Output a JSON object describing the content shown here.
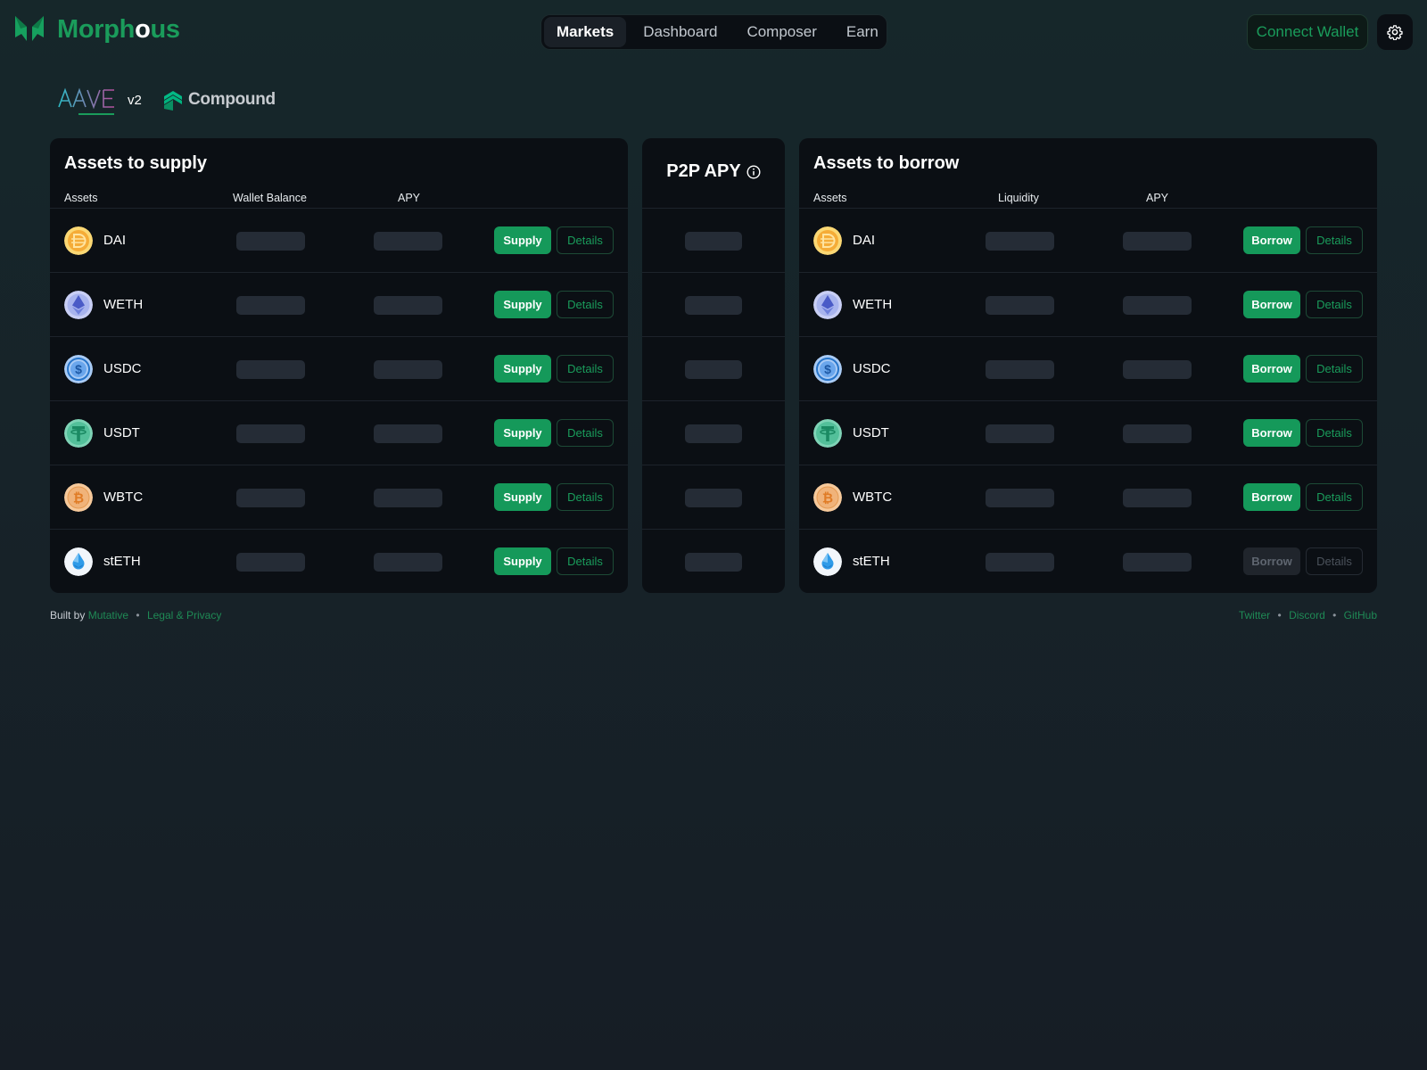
{
  "brand": {
    "name_part1": "Morph",
    "name_part2": "o",
    "name_part3": "us",
    "accent": "#1a9c5b"
  },
  "nav": {
    "items": [
      {
        "label": "Markets",
        "active": true
      },
      {
        "label": "Dashboard",
        "active": false
      },
      {
        "label": "Composer",
        "active": false
      },
      {
        "label": "Earn",
        "active": false
      }
    ]
  },
  "header": {
    "connect_label": "Connect Wallet",
    "settings_icon": "gear-icon"
  },
  "protocols": {
    "aave_label": "AAVE",
    "aave_version": "v2",
    "compound_label": "Compound"
  },
  "supply": {
    "title": "Assets to supply",
    "columns": [
      "Assets",
      "Wallet Balance",
      "APY"
    ],
    "action_label": "Supply",
    "details_label": "Details"
  },
  "p2p": {
    "title": "P2P APY",
    "icon": "info-icon"
  },
  "borrow": {
    "title": "Assets to borrow",
    "columns": [
      "Assets",
      "Liquidity",
      "APY"
    ],
    "action_label": "Borrow",
    "details_label": "Details"
  },
  "assets": [
    {
      "symbol": "DAI",
      "icon": "dai-icon",
      "color": "#f5ac37",
      "borrow_enabled": true
    },
    {
      "symbol": "WETH",
      "icon": "eth-icon",
      "color": "#627eea",
      "borrow_enabled": true
    },
    {
      "symbol": "USDC",
      "icon": "usdc-icon",
      "color": "#2775ca",
      "borrow_enabled": true
    },
    {
      "symbol": "USDT",
      "icon": "usdt-icon",
      "color": "#26a17b",
      "borrow_enabled": true
    },
    {
      "symbol": "WBTC",
      "icon": "btc-icon",
      "color": "#f09242",
      "borrow_enabled": true
    },
    {
      "symbol": "stETH",
      "icon": "steth-icon",
      "color": "#00a3ff",
      "borrow_enabled": false
    }
  ],
  "footer": {
    "built_by": "Built by",
    "author": "Mutative",
    "legal": "Legal & Privacy",
    "links": [
      "Twitter",
      "Discord",
      "GitHub"
    ]
  }
}
